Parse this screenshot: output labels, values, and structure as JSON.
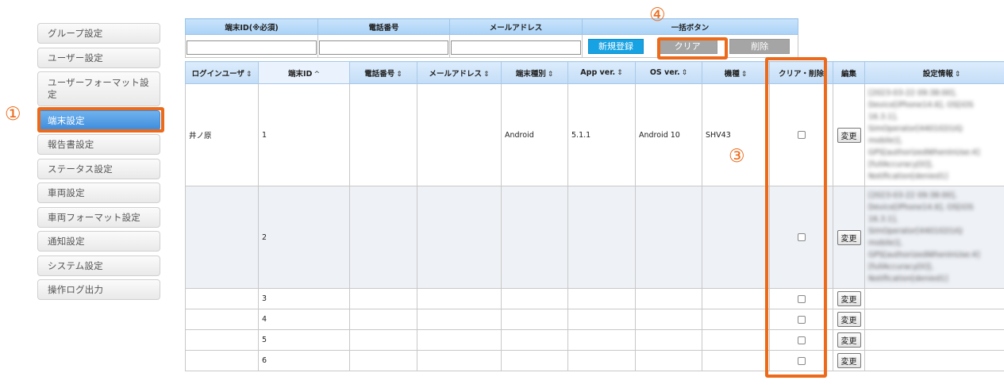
{
  "sidebar": {
    "items": [
      {
        "label": "グループ設定"
      },
      {
        "label": "ユーザー設定"
      },
      {
        "label": "ユーザーフォーマット設定"
      },
      {
        "label": "端末設定"
      },
      {
        "label": "報告書設定"
      },
      {
        "label": "ステータス設定"
      },
      {
        "label": "車両設定"
      },
      {
        "label": "車両フォーマット設定"
      },
      {
        "label": "通知設定"
      },
      {
        "label": "システム設定"
      },
      {
        "label": "操作ログ出力"
      }
    ],
    "active_index": 3
  },
  "search": {
    "headers": [
      "端末ID(※必須)",
      "電話番号",
      "メールアドレス",
      "一括ボタン"
    ],
    "inputs": [
      "",
      "",
      ""
    ],
    "new_button": "新規登録",
    "clear_button": "クリア",
    "delete_button": "削除"
  },
  "grid": {
    "headers": {
      "login_user": "ログインユーザ",
      "device_id": "端末ID",
      "phone": "電話番号",
      "email": "メールアドレス",
      "device_type": "端末種別",
      "app_ver": "App ver.",
      "os_ver": "OS ver.",
      "model": "機種",
      "clear_delete": "クリア・削除",
      "edit": "編集",
      "settings": "設定情報"
    },
    "sort_icon": "⇕",
    "sorted_icon": "^",
    "change_label": "変更",
    "rows": [
      {
        "login_user": "井ノ原",
        "device_id": "1",
        "phone": "",
        "email": "",
        "device_type": "Android",
        "app_ver": "5.1.1",
        "os_ver": "Android 10",
        "model": "SHV43",
        "checked": true,
        "settings": "[2023-03-22 09:38:00], Device[iPhone14.6], OS[iOS 16.3.1], SimOperator[440102(UQ mobile)], GPS[authorizedWhenInUse:4][fullAccuracy[0]], Notification[denied1]"
      },
      {
        "login_user": "",
        "device_id": "2",
        "phone": "",
        "email": "",
        "device_type": "",
        "app_ver": "",
        "os_ver": "",
        "model": "",
        "checked": false,
        "settings": "[2023-03-22 09:38:00], Device[iPhone14.6], OS[iOS 16.3.1], SimOperator[440102(UQ mobile)], GPS[authorizedWhenInUse:4][fullAccuracy[0]], Notification[denied1]"
      },
      {
        "login_user": "",
        "device_id": "3",
        "phone": "",
        "email": "",
        "device_type": "",
        "app_ver": "",
        "os_ver": "",
        "model": "",
        "checked": false,
        "settings": ""
      },
      {
        "login_user": "",
        "device_id": "4",
        "phone": "",
        "email": "",
        "device_type": "",
        "app_ver": "",
        "os_ver": "",
        "model": "",
        "checked": false,
        "settings": ""
      },
      {
        "login_user": "",
        "device_id": "5",
        "phone": "",
        "email": "",
        "device_type": "",
        "app_ver": "",
        "os_ver": "",
        "model": "",
        "checked": false,
        "settings": ""
      },
      {
        "login_user": "",
        "device_id": "6",
        "phone": "",
        "email": "",
        "device_type": "",
        "app_ver": "",
        "os_ver": "",
        "model": "",
        "checked": false,
        "settings": ""
      }
    ]
  },
  "annotations": {
    "n1": "①",
    "n3": "③",
    "n4": "④",
    "color": "#ec6a1a"
  }
}
